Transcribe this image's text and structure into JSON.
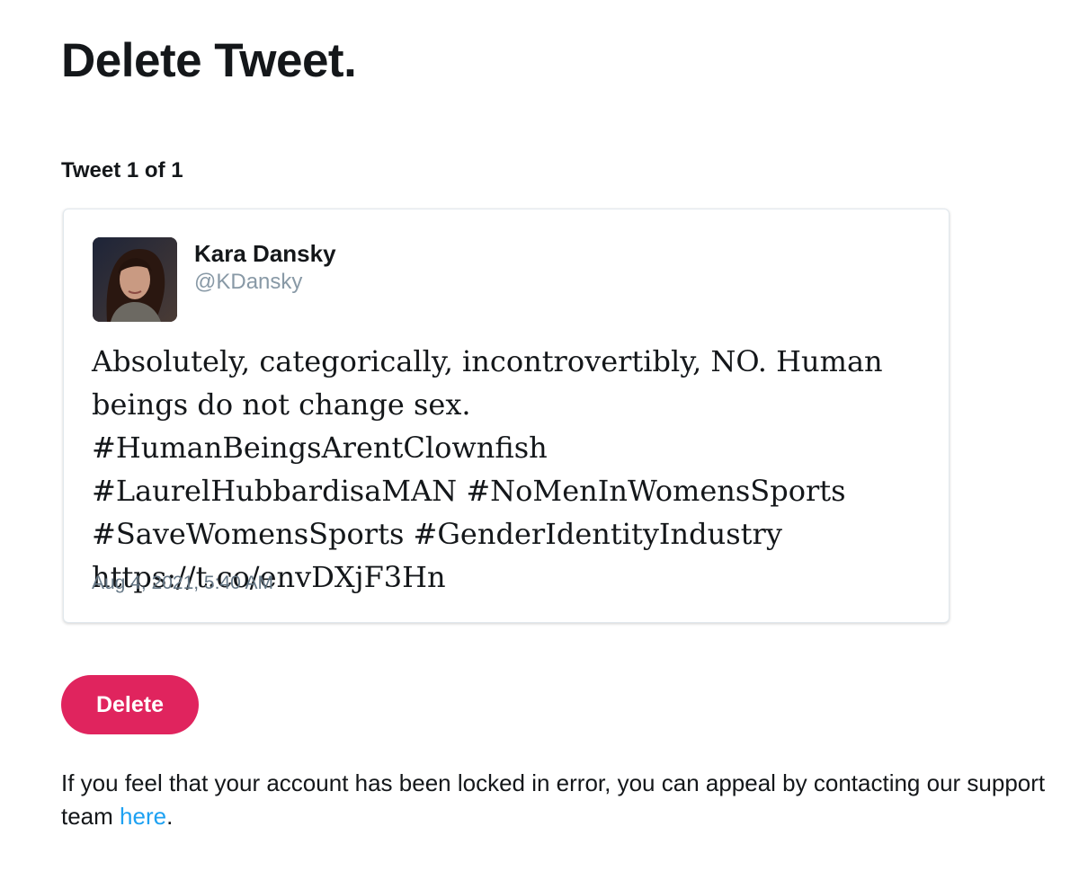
{
  "page": {
    "title": "Delete Tweet.",
    "counter": "Tweet 1 of 1"
  },
  "tweet": {
    "avatar_icon": "user-avatar-photo",
    "display_name": "Kara Dansky",
    "screen_name": "@KDansky",
    "text": "Absolutely, categorically, incontrovertibly, NO. Human\nbeings do not change sex. #HumanBeingsArentClownfish\n#LaurelHubbardisaMAN #NoMenInWomensSports\n#SaveWomensSports #GenderIdentityIndustry\nhttps://t.co/envDXjF3Hn",
    "timestamp": "Aug 4, 2021, 5:40 AM"
  },
  "actions": {
    "delete_label": "Delete"
  },
  "footer": {
    "appeal_text_before": "If you feel that your account has been locked in error, you can appeal by contacting our support team ",
    "appeal_link_label": "here",
    "appeal_text_after": "."
  },
  "colors": {
    "delete_button": "#e0245e",
    "link": "#1da1f2",
    "screen_name": "#8899a6",
    "timestamp": "#657786",
    "text": "#14171a"
  }
}
